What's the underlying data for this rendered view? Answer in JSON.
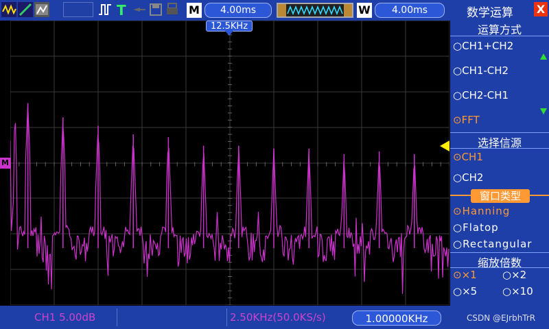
{
  "toolbar": {
    "m_label": "M",
    "timebase": "4.00ms",
    "w_label": "W",
    "window_time": "4.00ms",
    "freq_marker": "12.5KHz"
  },
  "panel": {
    "title": "数学运算",
    "close": "X",
    "operation_header": "运算方式",
    "operations": [
      {
        "label": "CH1+CH2",
        "selected": false
      },
      {
        "label": "CH1-CH2",
        "selected": false
      },
      {
        "label": "CH2-CH1",
        "selected": false
      },
      {
        "label": "FFT",
        "selected": true
      }
    ],
    "source_header": "选择信源",
    "sources": [
      {
        "label": "CH1",
        "selected": true
      },
      {
        "label": "CH2",
        "selected": false
      }
    ],
    "window_header": "窗口类型",
    "windows": [
      {
        "label": "Hanning",
        "selected": true
      },
      {
        "label": "Flatop",
        "selected": false
      },
      {
        "label": "Rectangular",
        "selected": false
      }
    ],
    "zoom_header": "缩放倍数",
    "zooms": [
      {
        "label": "×1",
        "selected": true
      },
      {
        "label": "×2",
        "selected": false
      },
      {
        "label": "×5",
        "selected": false
      },
      {
        "label": "×10",
        "selected": false
      }
    ]
  },
  "bottom": {
    "channel_scale": "CH1 5.00dB",
    "span": "2.50KHz(50.0KS/s)",
    "center": "1.00000KHz",
    "watermark": "CSDN @EJrbhTrR"
  },
  "markers": {
    "left": "M"
  },
  "colors": {
    "trace": "#cc33cc",
    "grid": "#3a3a3a",
    "bar": "#1f3fa8",
    "selected": "#ff9933",
    "arrow": "#ffee00"
  },
  "chart_data": {
    "type": "line",
    "title": "",
    "xlabel": "",
    "ylabel": "",
    "grid": true,
    "series": [
      {
        "peaks": [
          1,
          2,
          3,
          4,
          5,
          6,
          7,
          8,
          9,
          10,
          11,
          12
        ],
        "values": [
          {
            "x": 0.04,
            "y": 0.29
          },
          {
            "x": 0.12,
            "y": 0.34
          },
          {
            "x": 0.2,
            "y": 0.37
          },
          {
            "x": 0.28,
            "y": 0.4
          },
          {
            "x": 0.36,
            "y": 0.41
          },
          {
            "x": 0.44,
            "y": 0.44
          },
          {
            "x": 0.52,
            "y": 0.44
          },
          {
            "x": 0.6,
            "y": 0.45
          },
          {
            "x": 0.68,
            "y": 0.45
          },
          {
            "x": 0.76,
            "y": 0.47
          },
          {
            "x": 0.84,
            "y": 0.46
          },
          {
            "x": 0.92,
            "y": 0.47
          }
        ]
      }
    ]
  }
}
